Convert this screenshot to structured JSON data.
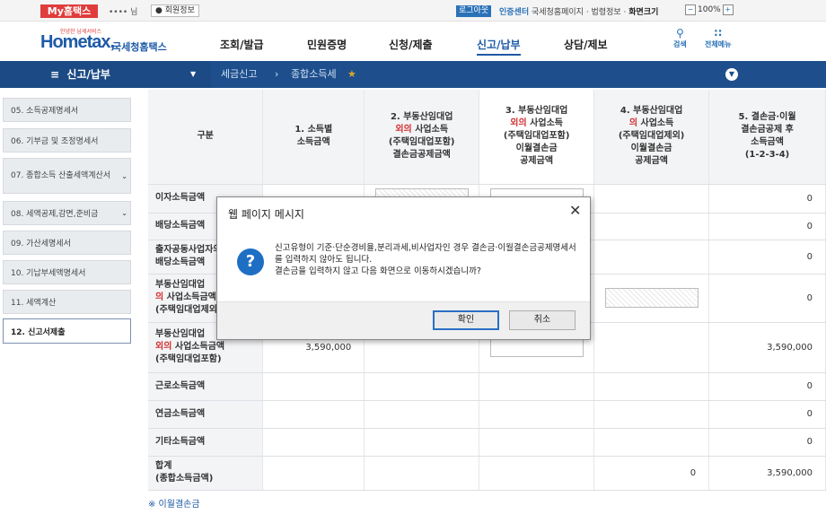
{
  "topbar": {
    "my_home": "My홈택스",
    "user_name": "•••• 님",
    "member_info": "회원정보",
    "logout": "로그아웃",
    "cert_center": "인증센터",
    "links": "국세청홈페이지 · 법령정보 ·",
    "zoom_label": "화면크기",
    "zoom_value": "100%"
  },
  "header": {
    "logo_main": "Hometax,",
    "logo_sub": "국세청홈택스",
    "logo_small": "안녕한 납세서비스",
    "nav": [
      "조회/발급",
      "민원증명",
      "신청/제출",
      "신고/납부",
      "상담/제보"
    ],
    "active_nav": "신고/납부",
    "search_label": "검색",
    "all_menu_label": "전체메뉴"
  },
  "breadcrumb": {
    "menu": "신고/납부",
    "items": [
      "세금신고",
      "종합소득세"
    ]
  },
  "sidebar": {
    "items": [
      {
        "label": "05. 소득공제명세서"
      },
      {
        "label": "06. 기부금 및 조정명세서"
      },
      {
        "label": "07. 종합소득 산출세액계산서"
      },
      {
        "label": "08. 세액공제,감면,준비금"
      },
      {
        "label": "09. 가산세명세서"
      },
      {
        "label": "10. 기납부세액명세서"
      },
      {
        "label": "11. 세액계산"
      },
      {
        "label": "12. 신고서제출"
      }
    ],
    "active_index": 7
  },
  "table": {
    "headers": {
      "col0": "구분",
      "col1": "1. 소득별\n소득금액",
      "col2_pre": "2. 부동산임대업\n",
      "col2_red": "외의",
      "col2_post": " 사업소득\n(주택임대업포함)\n결손금공제금액",
      "col3_pre": "3. 부동산임대업\n",
      "col3_red": "외의",
      "col3_post": " 사업소득\n(주택임대업포함)\n이월결손금\n공제금액",
      "col4_pre": "4. 부동산임대업\n",
      "col4_red": "의",
      "col4_post": " 사업소득\n(주택임대업제외)\n이월결손금\n공제금액",
      "col5": "5. 결손금·이월\n결손금공제 후\n소득금액\n(1-2-3-4)"
    },
    "rows": [
      {
        "label": "이자소득금액",
        "c1": "",
        "c4": "",
        "c5": "0"
      },
      {
        "label": "배당소득금액",
        "c1": "",
        "c4": "",
        "c5": "0"
      },
      {
        "label": "출자공동사업자의\n배당소득금액",
        "c1": "",
        "c4": "",
        "c5": "0"
      },
      {
        "label_pre": "부동산임대업\n",
        "label_red": "의",
        "label_post": " 사업소득금액\n(주택임대업제외)",
        "c1": "",
        "c4": "",
        "c5": "0"
      },
      {
        "label_pre": "부동산임대업\n",
        "label_red": "외의",
        "label_post": " 사업소득금액\n(주택임대업포함)",
        "c1": "3,590,000",
        "c4": "",
        "c5": "3,590,000"
      },
      {
        "label": "근로소득금액",
        "c1": "",
        "c4": "",
        "c5": "0"
      },
      {
        "label": "연금소득금액",
        "c1": "",
        "c4": "",
        "c5": "0"
      },
      {
        "label": "기타소득금액",
        "c1": "",
        "c4": "",
        "c5": "0"
      },
      {
        "label": "합계\n(종합소득금액)",
        "c1": "",
        "c4": "0",
        "c5": "3,590,000"
      }
    ]
  },
  "footnote": "※ 이월결손금",
  "dialog": {
    "title": "웹 페이지 메시지",
    "message": "신고유형이 기준·단순경비율,분리과세,비사업자인 경우 결손금·이월결손금공제명세서를 입력하지 않아도 됩니다.\n결손금을 입력하지 않고 다음 화면으로 이동하시겠습니까?",
    "ok": "확인",
    "cancel": "취소"
  }
}
